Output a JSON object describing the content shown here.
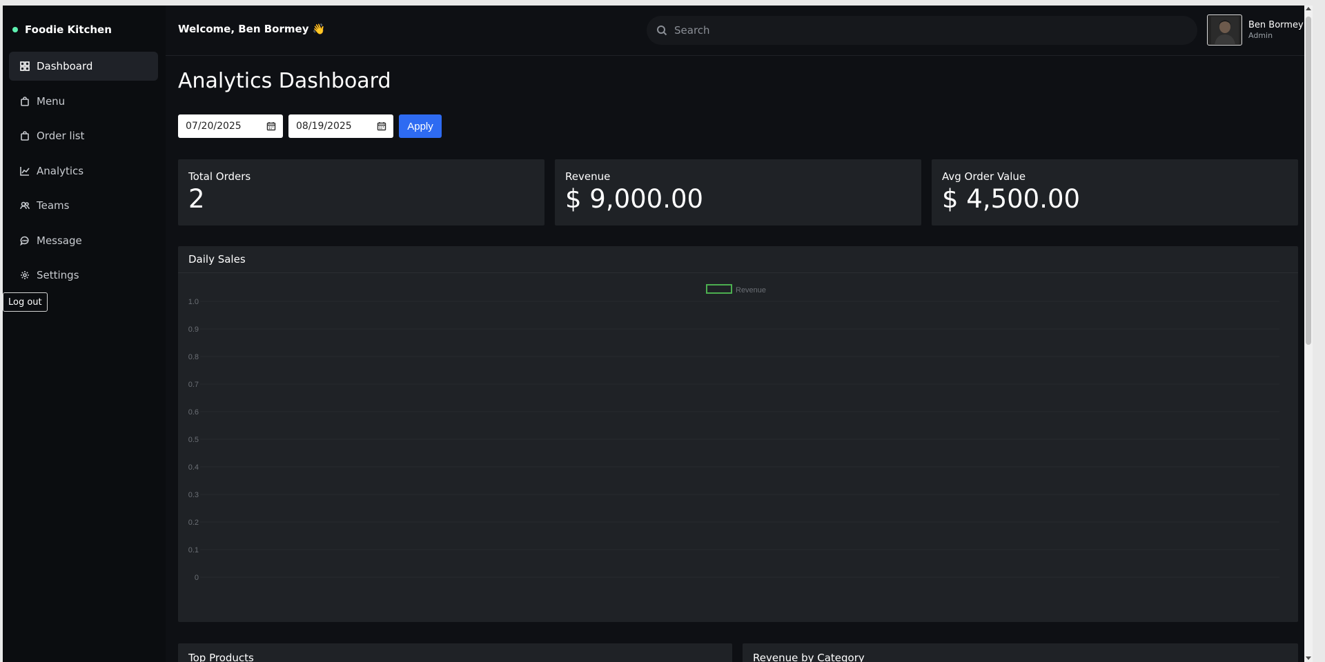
{
  "brand": {
    "name": "Foodie Kitchen",
    "dot_color": "#5ef0b0"
  },
  "sidebar": {
    "items": [
      {
        "label": "Dashboard",
        "icon": "grid-icon",
        "active": true
      },
      {
        "label": "Menu",
        "icon": "bag-icon"
      },
      {
        "label": "Order list",
        "icon": "bag-icon"
      },
      {
        "label": "Analytics",
        "icon": "line-chart-icon"
      },
      {
        "label": "Teams",
        "icon": "users-icon"
      },
      {
        "label": "Message",
        "icon": "message-icon"
      },
      {
        "label": "Settings",
        "icon": "gear-icon"
      }
    ],
    "logout_label": "Log out"
  },
  "header": {
    "welcome": "Welcome, Ben Bormey 👋",
    "search_placeholder": "Search",
    "user_name": "Ben Bormey",
    "user_role": "Admin"
  },
  "page": {
    "title": "Analytics Dashboard",
    "start_date": "07/20/2025",
    "end_date": "08/19/2025",
    "apply_label": "Apply"
  },
  "stats": [
    {
      "label": "Total Orders",
      "value": "2"
    },
    {
      "label": "Revenue",
      "value": "$ 9,000.00"
    },
    {
      "label": "Avg Order Value",
      "value": "$ 4,500.00"
    }
  ],
  "daily_sales": {
    "title": "Daily Sales"
  },
  "chart_data": {
    "type": "bar",
    "series": [
      {
        "name": "Revenue",
        "values": [],
        "color": "#4caf50"
      }
    ],
    "categories": [],
    "yticks": [
      "0",
      "0.1",
      "0.2",
      "0.3",
      "0.4",
      "0.5",
      "0.6",
      "0.7",
      "0.8",
      "0.9",
      "1.0"
    ],
    "ylim": [
      0,
      1
    ],
    "legend": "top-center",
    "grid": true
  },
  "bottom_panels": {
    "top_products": "Top Products",
    "revenue_by_category": "Revenue by Category"
  },
  "colors": {
    "accent": "#2e6bf2",
    "background": "#0e1014",
    "card": "#1f2226"
  }
}
